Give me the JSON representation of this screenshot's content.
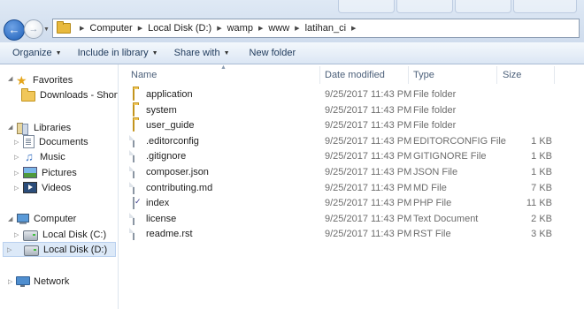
{
  "address": {
    "crumbs": [
      "Computer",
      "Local Disk (D:)",
      "wamp",
      "www",
      "latihan_ci"
    ]
  },
  "toolbar": {
    "organize": "Organize",
    "include_in_library": "Include in library",
    "share_with": "Share with",
    "new_folder": "New folder"
  },
  "sidebar": {
    "favorites": "Favorites",
    "downloads": "Downloads - Shortcu",
    "libraries": "Libraries",
    "documents": "Documents",
    "music": "Music",
    "pictures": "Pictures",
    "videos": "Videos",
    "computer": "Computer",
    "disk_c": "Local Disk (C:)",
    "disk_d": "Local Disk (D:)",
    "network": "Network"
  },
  "columns": {
    "name": "Name",
    "date_modified": "Date modified",
    "type": "Type",
    "size": "Size"
  },
  "files": [
    {
      "name": "application",
      "date": "9/25/2017 11:43 PM",
      "type": "File folder",
      "size": "",
      "icon": "folder-icon"
    },
    {
      "name": "system",
      "date": "9/25/2017 11:43 PM",
      "type": "File folder",
      "size": "",
      "icon": "folder-icon"
    },
    {
      "name": "user_guide",
      "date": "9/25/2017 11:43 PM",
      "type": "File folder",
      "size": "",
      "icon": "folder-icon"
    },
    {
      "name": ".editorconfig",
      "date": "9/25/2017 11:43 PM",
      "type": "EDITORCONFIG File",
      "size": "1 KB",
      "icon": "file-icon"
    },
    {
      "name": ".gitignore",
      "date": "9/25/2017 11:43 PM",
      "type": "GITIGNORE File",
      "size": "1 KB",
      "icon": "file-icon"
    },
    {
      "name": "composer.json",
      "date": "9/25/2017 11:43 PM",
      "type": "JSON File",
      "size": "1 KB",
      "icon": "file-icon"
    },
    {
      "name": "contributing.md",
      "date": "9/25/2017 11:43 PM",
      "type": "MD File",
      "size": "7 KB",
      "icon": "file-icon"
    },
    {
      "name": "index",
      "date": "9/25/2017 11:43 PM",
      "type": "PHP File",
      "size": "11 KB",
      "icon": "php-file-icon"
    },
    {
      "name": "license",
      "date": "9/25/2017 11:43 PM",
      "type": "Text Document",
      "size": "2 KB",
      "icon": "file-icon"
    },
    {
      "name": "readme.rst",
      "date": "9/25/2017 11:43 PM",
      "type": "RST File",
      "size": "3 KB",
      "icon": "file-icon"
    }
  ],
  "colors": {
    "selection": "#dce9f8",
    "toolbar_text": "#1e395b",
    "header_text": "#4c607a"
  }
}
